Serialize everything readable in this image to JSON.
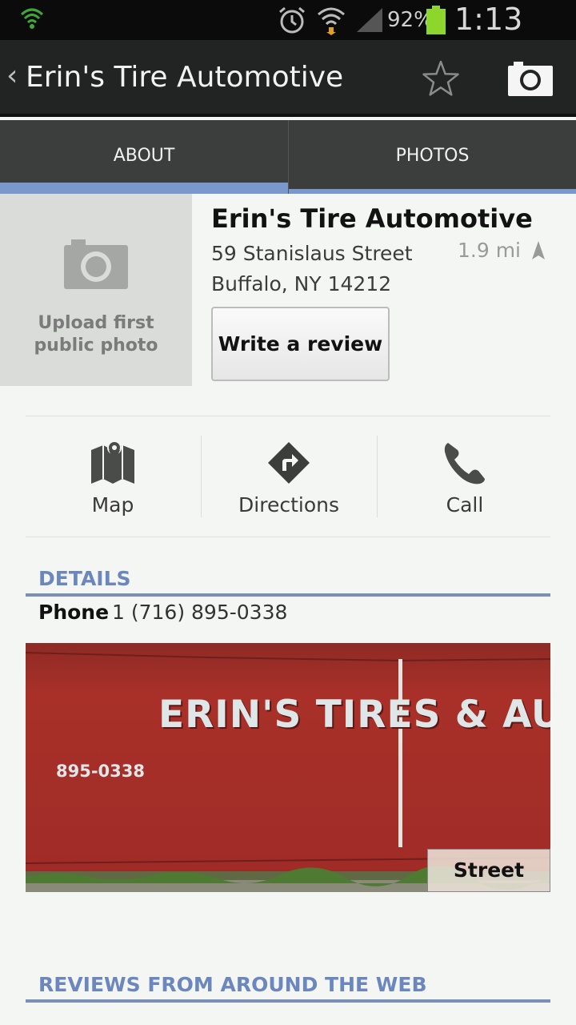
{
  "status_bar": {
    "battery_percent": "92%",
    "time": "1:13 PM",
    "icons": [
      "shield-icon",
      "alarm-icon",
      "wifi-icon",
      "signal-icon",
      "battery-icon"
    ]
  },
  "action_bar": {
    "back_glyph": "‹",
    "title": "Erin's Tire Automotive",
    "icons": [
      "star-icon",
      "camera-icon"
    ]
  },
  "tabs": [
    {
      "label": "ABOUT",
      "selected": true
    },
    {
      "label": "PHOTOS",
      "selected": false
    }
  ],
  "place": {
    "photo_placeholder": "Upload first public photo",
    "name": "Erin's Tire Automotive",
    "address_line1": "59 Stanislaus Street",
    "address_line2": "Buffalo, NY 14212",
    "distance": "1.9 mi",
    "write_review_label": "Write a review"
  },
  "quick_actions": {
    "map": "Map",
    "directions": "Directions",
    "call": "Call"
  },
  "details": {
    "heading": "DETAILS",
    "phone_label": "Phone",
    "phone_value": "1 (716) 895-0338"
  },
  "street_view": {
    "sign_text": "ERIN'S TIRES & AUTO",
    "sign_phone": "895-0338",
    "button_label": "Street View"
  },
  "reviews": {
    "heading": "REVIEWS FROM AROUND THE WEB"
  },
  "colors": {
    "accent": "#7a98cc",
    "section_heading": "#6c87bd",
    "battery": "#8dd62b",
    "wall": "#a22c26"
  }
}
